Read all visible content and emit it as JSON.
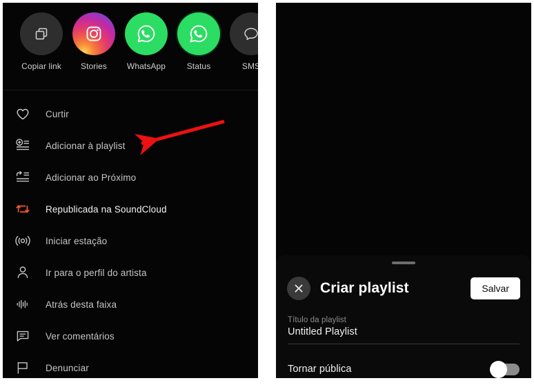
{
  "share": {
    "items": [
      {
        "label": "Copiar link",
        "icon": "copy-link-icon",
        "style": "grey"
      },
      {
        "label": "Stories",
        "icon": "instagram-icon",
        "style": "instagram"
      },
      {
        "label": "WhatsApp",
        "icon": "whatsapp-icon",
        "style": "whatsapp"
      },
      {
        "label": "Status",
        "icon": "whatsapp-status-icon",
        "style": "whatsapp-status"
      },
      {
        "label": "SMS",
        "icon": "sms-icon",
        "style": "grey"
      }
    ]
  },
  "menu": {
    "items": [
      {
        "label": "Curtir",
        "icon": "heart-icon"
      },
      {
        "label": "Adicionar à playlist",
        "icon": "add-to-playlist-icon"
      },
      {
        "label": "Adicionar ao Próximo",
        "icon": "add-to-next-up-icon"
      },
      {
        "label": "Republicada na SoundCloud",
        "icon": "repost-icon"
      },
      {
        "label": "Iniciar estação",
        "icon": "station-icon"
      },
      {
        "label": "Ir para o perfil do artista",
        "icon": "person-icon"
      },
      {
        "label": "Atrás desta faixa",
        "icon": "waveform-icon"
      },
      {
        "label": "Ver comentários",
        "icon": "comment-icon"
      },
      {
        "label": "Denunciar",
        "icon": "flag-icon"
      }
    ]
  },
  "annotation": {
    "arrow": "red-arrow-pointing-to-add-to-playlist"
  },
  "sheet": {
    "title": "Criar playlist",
    "save_label": "Salvar",
    "close_icon": "close-icon",
    "grabber": "drag-handle",
    "field": {
      "label": "Título da playlist",
      "value": "Untitled Playlist"
    },
    "toggle": {
      "label": "Tornar pública",
      "state": "off"
    }
  },
  "colors": {
    "background": "#050505",
    "accent_repost": "#f2572a",
    "accent_whatsapp": "#2bdd62",
    "arrow": "#ee1111",
    "text_primary": "#f2f2f2",
    "text_secondary": "#c6c6c6",
    "text_muted": "#8d8d8d"
  }
}
